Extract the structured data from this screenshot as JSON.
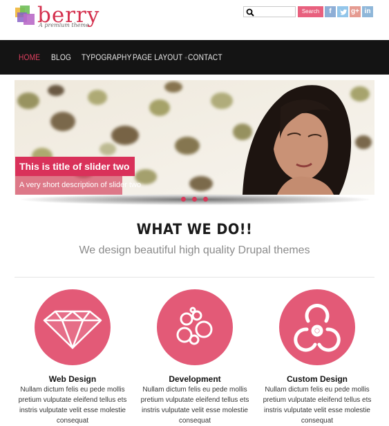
{
  "brand": {
    "name": "berry",
    "tagline": "A premium theme"
  },
  "search": {
    "placeholder": "",
    "button_label": "Search"
  },
  "social": [
    {
      "name": "facebook",
      "glyph": "f",
      "color": "#8eaed6"
    },
    {
      "name": "twitter",
      "glyph": "t",
      "color": "#93c6ea"
    },
    {
      "name": "google-plus",
      "glyph": "g+",
      "color": "#e59b91"
    },
    {
      "name": "linkedin",
      "glyph": "in",
      "color": "#8fb7d9"
    }
  ],
  "nav": {
    "items": [
      {
        "label": "HOME",
        "active": true
      },
      {
        "label": "BLOG",
        "active": false
      },
      {
        "label": "TYPOGRAPHY",
        "active": false
      },
      {
        "label": "PAGE LAYOUT",
        "active": false,
        "caret": "+"
      },
      {
        "label": "CONTACT",
        "active": false
      }
    ]
  },
  "slider": {
    "title": "This is title of slider two",
    "description": "A very short description of slider two",
    "active_slide": 2,
    "slide_count": 3
  },
  "section": {
    "heading": "WHAT WE DO!!",
    "subheading": "We design beautiful high quality Drupal themes"
  },
  "features": [
    {
      "icon": "diamond-icon",
      "title": "Web Design",
      "text": "Nullam dictum felis eu pede mollis pretium vulputate eleifend tellus ets instris vulputate velit esse molestie consequat"
    },
    {
      "icon": "bubbles-icon",
      "title": "Development",
      "text": "Nullam dictum felis eu pede mollis pretium vulputate eleifend tellus ets instris vulputate velit esse molestie consequat"
    },
    {
      "icon": "biohazard-icon",
      "title": "Custom Design",
      "text": "Nullam dictum felis eu pede mollis pretium vulputate eleifend tellus ets instris vulputate velit esse molestie consequat"
    }
  ],
  "colors": {
    "accent": "#e35a77",
    "nav_bg": "#141414",
    "brand": "#d4304e"
  }
}
